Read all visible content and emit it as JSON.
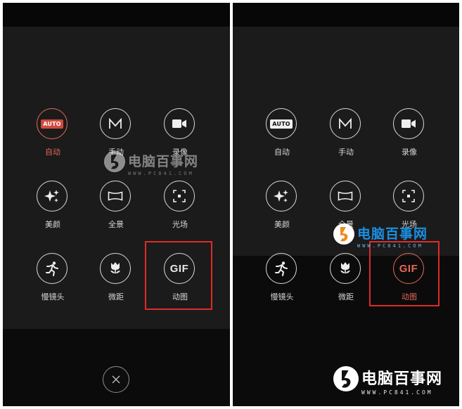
{
  "left_panel": {
    "modes": [
      {
        "id": "auto",
        "label": "自动",
        "icon_text": "AUTO",
        "icon": "auto-badge-icon",
        "active": true
      },
      {
        "id": "manual",
        "label": "手动",
        "icon": "m-letter-icon",
        "active": false
      },
      {
        "id": "video",
        "label": "录像",
        "icon": "video-camera-icon",
        "active": false
      },
      {
        "id": "beauty",
        "label": "美颜",
        "icon": "sparkle-icon",
        "active": false
      },
      {
        "id": "panorama",
        "label": "全景",
        "icon": "panorama-icon",
        "active": false
      },
      {
        "id": "light",
        "label": "光场",
        "icon": "focus-frame-icon",
        "active": false
      },
      {
        "id": "slowmo",
        "label": "慢镜头",
        "icon": "running-man-icon",
        "active": false
      },
      {
        "id": "macro",
        "label": "微距",
        "icon": "flower-icon",
        "active": false
      },
      {
        "id": "gif",
        "label": "动图",
        "icon_text": "GIF",
        "icon": "gif-icon",
        "active": false
      }
    ],
    "close_icon": "close-icon"
  },
  "right_panel": {
    "modes": [
      {
        "id": "auto",
        "label": "自动",
        "icon_text": "AUTO",
        "icon": "auto-badge-icon",
        "active": false
      },
      {
        "id": "manual",
        "label": "手动",
        "icon": "m-letter-icon",
        "active": false
      },
      {
        "id": "video",
        "label": "录像",
        "icon": "video-camera-icon",
        "active": false
      },
      {
        "id": "beauty",
        "label": "美颜",
        "icon": "sparkle-icon",
        "active": false
      },
      {
        "id": "panorama",
        "label": "全景",
        "icon": "panorama-icon",
        "active": false
      },
      {
        "id": "light",
        "label": "光场",
        "icon": "focus-frame-icon",
        "active": false
      },
      {
        "id": "slowmo",
        "label": "慢镜头",
        "icon": "running-man-icon",
        "active": false
      },
      {
        "id": "macro",
        "label": "微距",
        "icon": "flower-icon",
        "active": false
      },
      {
        "id": "gif",
        "label": "动图",
        "icon_text": "GIF",
        "icon": "gif-icon",
        "active": true
      }
    ]
  },
  "watermark": {
    "name": "电脑百事网",
    "url": "WWW.PC841.COM"
  },
  "colors": {
    "accent": "#e8665a",
    "highlight_box": "#e02a2a",
    "background": "#1b1b1b"
  }
}
